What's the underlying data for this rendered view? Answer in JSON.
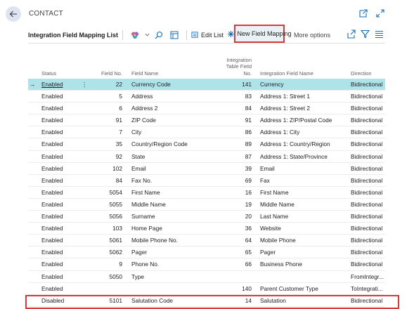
{
  "header": {
    "caption": "CONTACT"
  },
  "toolbar": {
    "title": "Integration Field Mapping List",
    "edit_list": "Edit List",
    "new_mapping": "New Field Mapping",
    "more_options": "More options"
  },
  "columns": {
    "status": "Status",
    "field_no": "Field No.",
    "field_name": "Field Name",
    "table_field": "Integration Table Field No.",
    "int_name": "Integration Field Name",
    "direction": "Direction"
  },
  "rows": [
    {
      "status": "Enabled",
      "field_no": "22",
      "field_name": "Currency Code",
      "table_field": "141",
      "int_name": "Currency",
      "direction": "Bidirectional"
    },
    {
      "status": "Enabled",
      "field_no": "5",
      "field_name": "Address",
      "table_field": "83",
      "int_name": "Address 1: Street 1",
      "direction": "Bidirectional"
    },
    {
      "status": "Enabled",
      "field_no": "6",
      "field_name": "Address 2",
      "table_field": "84",
      "int_name": "Address 1: Street 2",
      "direction": "Bidirectional"
    },
    {
      "status": "Enabled",
      "field_no": "91",
      "field_name": "ZIP Code",
      "table_field": "91",
      "int_name": "Address 1: ZIP/Postal Code",
      "direction": "Bidirectional"
    },
    {
      "status": "Enabled",
      "field_no": "7",
      "field_name": "City",
      "table_field": "86",
      "int_name": "Address 1: City",
      "direction": "Bidirectional"
    },
    {
      "status": "Enabled",
      "field_no": "35",
      "field_name": "Country/Region Code",
      "table_field": "89",
      "int_name": "Address 1: Country/Region",
      "direction": "Bidirectional"
    },
    {
      "status": "Enabled",
      "field_no": "92",
      "field_name": "State",
      "table_field": "87",
      "int_name": "Address 1: State/Province",
      "direction": "Bidirectional"
    },
    {
      "status": "Enabled",
      "field_no": "102",
      "field_name": "Email",
      "table_field": "39",
      "int_name": "Email",
      "direction": "Bidirectional"
    },
    {
      "status": "Enabled",
      "field_no": "84",
      "field_name": "Fax No.",
      "table_field": "69",
      "int_name": "Fax",
      "direction": "Bidirectional"
    },
    {
      "status": "Enabled",
      "field_no": "5054",
      "field_name": "First Name",
      "table_field": "16",
      "int_name": "First Name",
      "direction": "Bidirectional"
    },
    {
      "status": "Enabled",
      "field_no": "5055",
      "field_name": "Middle Name",
      "table_field": "19",
      "int_name": "Middle Name",
      "direction": "Bidirectional"
    },
    {
      "status": "Enabled",
      "field_no": "5056",
      "field_name": "Surname",
      "table_field": "20",
      "int_name": "Last Name",
      "direction": "Bidirectional"
    },
    {
      "status": "Enabled",
      "field_no": "103",
      "field_name": "Home Page",
      "table_field": "36",
      "int_name": "Website",
      "direction": "Bidirectional"
    },
    {
      "status": "Enabled",
      "field_no": "5061",
      "field_name": "Mobile Phone No.",
      "table_field": "64",
      "int_name": "Mobile Phone",
      "direction": "Bidirectional"
    },
    {
      "status": "Enabled",
      "field_no": "5062",
      "field_name": "Pager",
      "table_field": "65",
      "int_name": "Pager",
      "direction": "Bidirectional"
    },
    {
      "status": "Enabled",
      "field_no": "9",
      "field_name": "Phone No.",
      "table_field": "66",
      "int_name": "Business Phone",
      "direction": "Bidirectional"
    },
    {
      "status": "Enabled",
      "field_no": "5050",
      "field_name": "Type",
      "table_field": "",
      "int_name": "",
      "direction": "FromIntegr..."
    },
    {
      "status": "Enabled",
      "field_no": "",
      "field_name": "",
      "table_field": "140",
      "int_name": "Parent Customer Type",
      "direction": "ToIntegrati..."
    },
    {
      "status": "Disabled",
      "field_no": "5101",
      "field_name": "Salutation Code",
      "table_field": "14",
      "int_name": "Salutation",
      "direction": "Bidirectional"
    }
  ],
  "colors": {
    "accent": "#0f6cbd",
    "selected_row": "#aee3ea",
    "highlight_box": "#d73a3a"
  }
}
